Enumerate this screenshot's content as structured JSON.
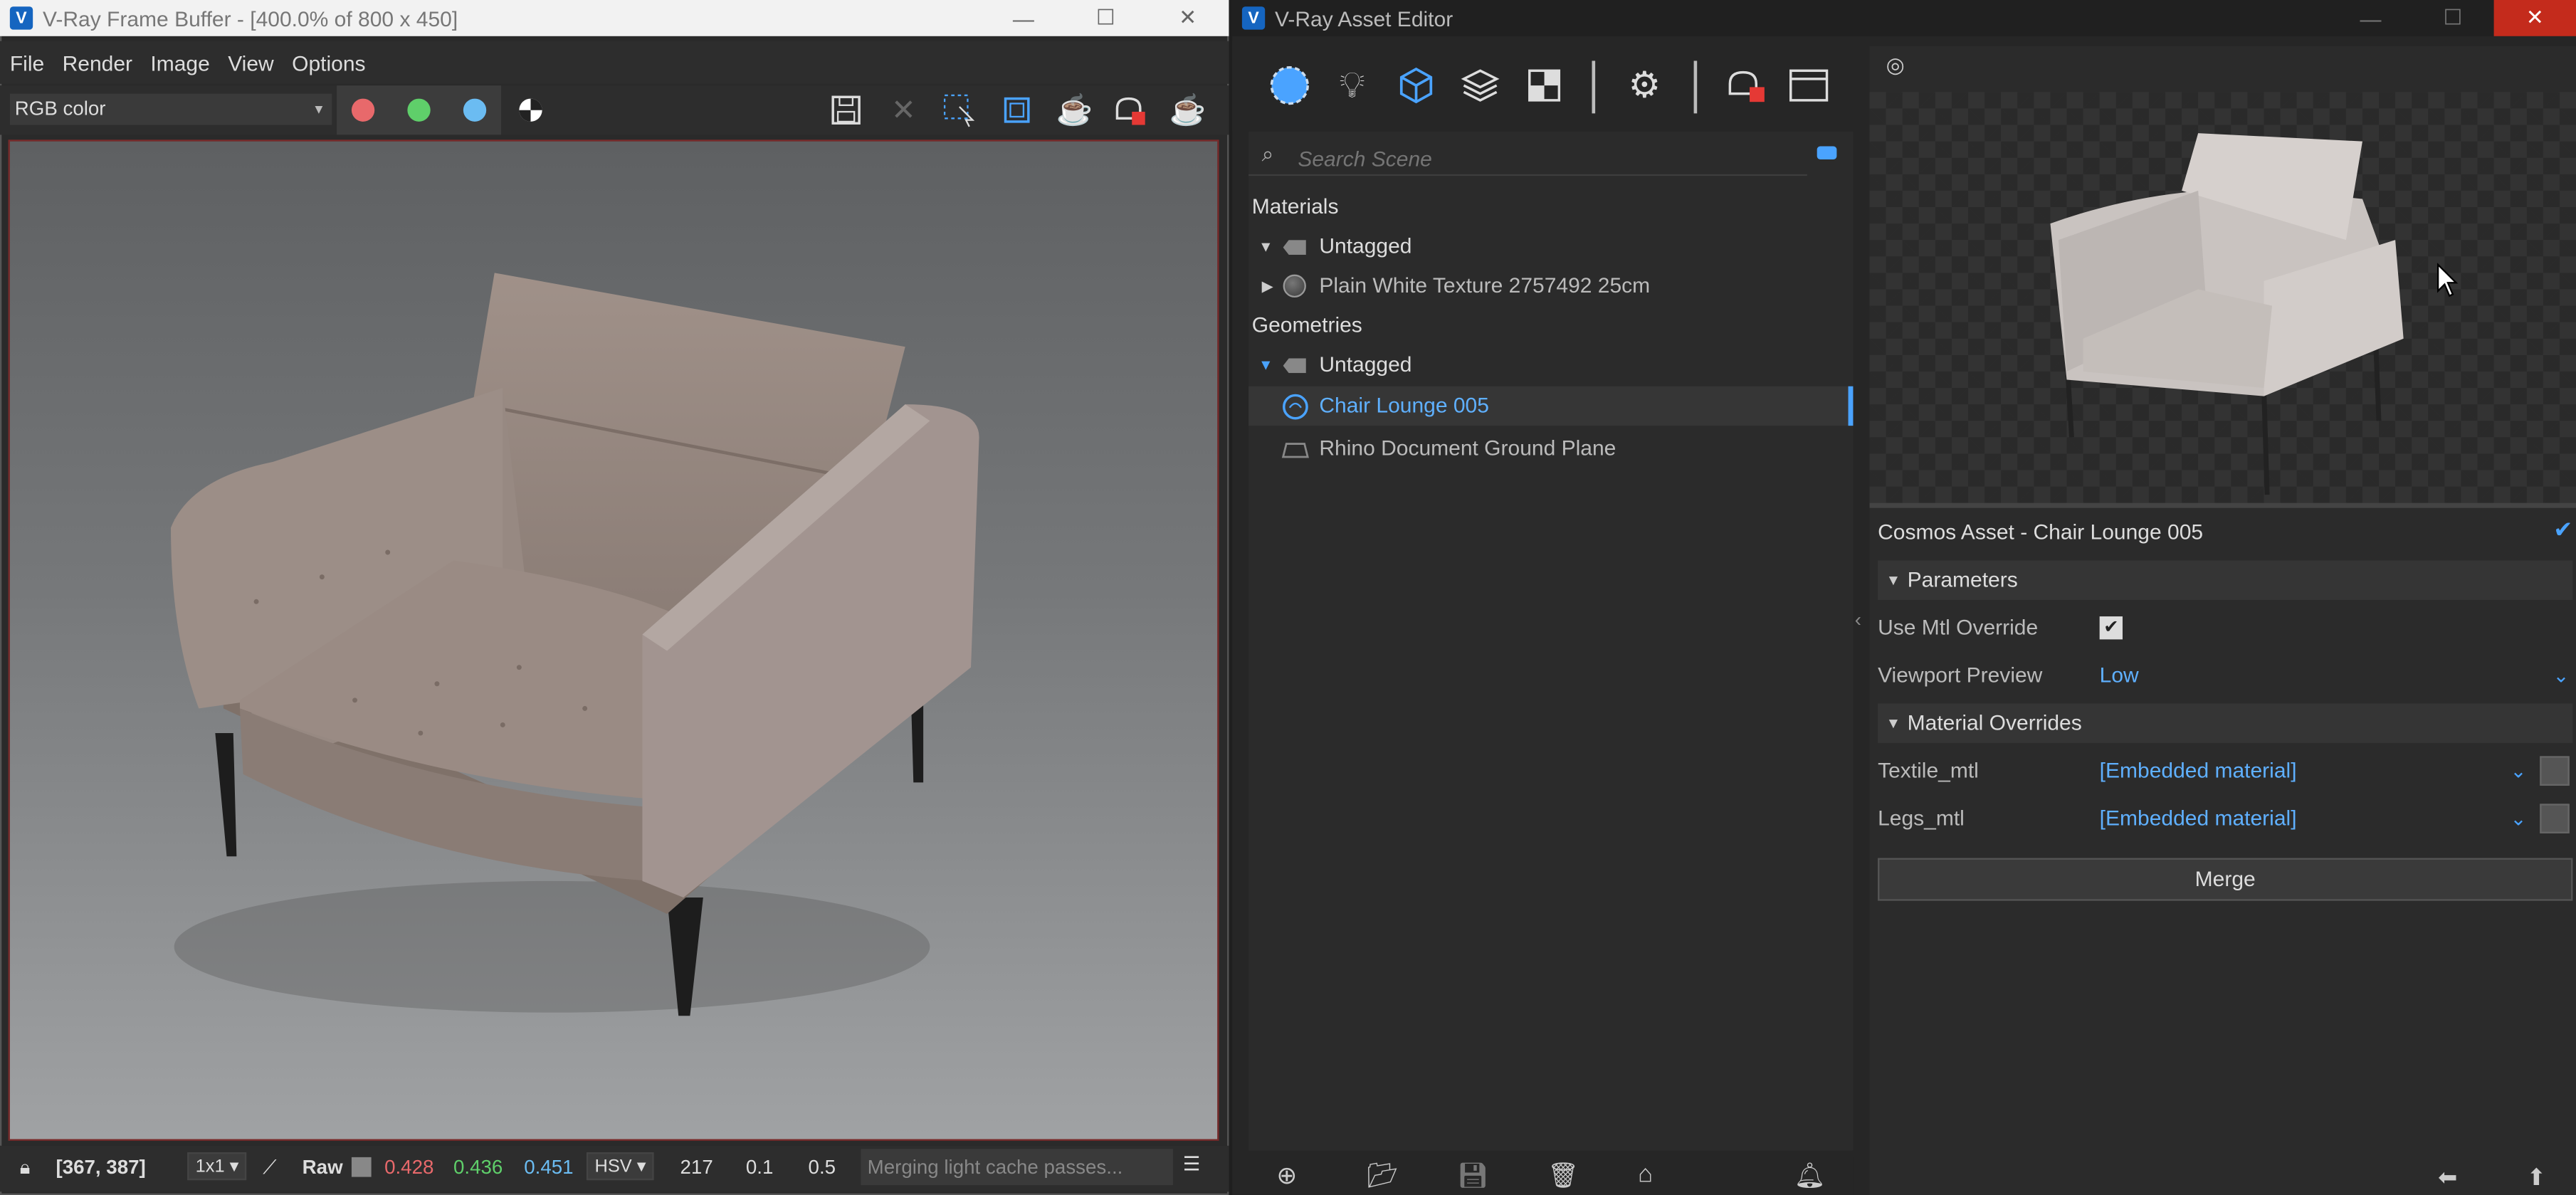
{
  "frame_buffer": {
    "title": "V-Ray Frame Buffer - [400.0% of 800 x 450]",
    "menu": [
      "File",
      "Render",
      "Image",
      "View",
      "Options"
    ],
    "channel_select": "RGB color",
    "status": {
      "coords": "[367, 387]",
      "ratio": "1x1",
      "mode": "Raw",
      "r": "0.428",
      "g": "0.436",
      "b": "0.451",
      "color_space": "HSV",
      "h": "217",
      "s": "0.1",
      "v": "0.5",
      "message": "Merging light cache passes..."
    },
    "colors": {
      "red": "#e8696b",
      "green": "#5fcf6a",
      "blue": "#6bbcf2"
    }
  },
  "asset_editor": {
    "title": "V-Ray Asset Editor",
    "search_placeholder": "Search Scene",
    "tree": {
      "materials_header": "Materials",
      "materials_tag": "Untagged",
      "material_item": "Plain White Texture 2757492 25cm",
      "geometries_header": "Geometries",
      "geometries_tag": "Untagged",
      "geometry_selected": "Chair Lounge 005",
      "geometry_item": "Rhino Document Ground Plane"
    },
    "properties": {
      "title": "Cosmos Asset - Chair Lounge 005",
      "parameters_header": "Parameters",
      "use_mtl_override_label": "Use Mtl Override",
      "viewport_preview_label": "Viewport Preview",
      "viewport_preview_value": "Low",
      "material_overrides_header": "Material Overrides",
      "textile_label": "Textile_mtl",
      "textile_value": "[Embedded material]",
      "legs_label": "Legs_mtl",
      "legs_value": "[Embedded material]",
      "merge_label": "Merge"
    },
    "accent": "#4aa3ff"
  }
}
